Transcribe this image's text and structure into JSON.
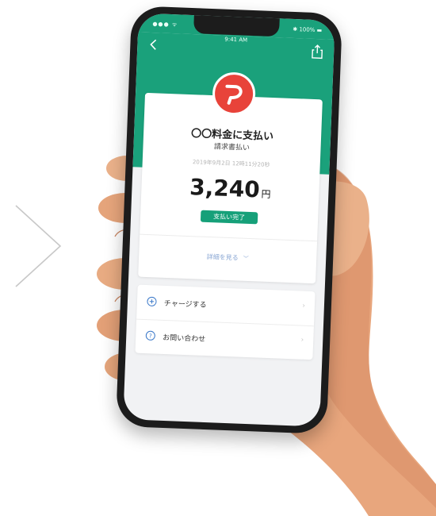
{
  "status_bar": {
    "signal": "●●● ᯤ",
    "time": "9:41 AM",
    "battery": "✱ 100% ▬"
  },
  "header": {
    "back_icon": "chevron-left-icon",
    "share_icon": "share-icon"
  },
  "receipt": {
    "logo_icon": "paypay-logo-icon",
    "title": "〇〇料金に支払い",
    "subtitle": "請求書払い",
    "datetime": "2019年9月2日 12時11分20秒",
    "amount": "3,240",
    "currency": "円",
    "status": "支払い完了",
    "details_link": "詳細を見る",
    "details_icon": "chevron-down-icon"
  },
  "actions": [
    {
      "icon": "plus-circle-icon",
      "label": "チャージする",
      "chevron": "›"
    },
    {
      "icon": "question-circle-icon",
      "label": "お問い合わせ",
      "chevron": "›"
    }
  ],
  "colors": {
    "brand_green": "#1aa17b",
    "logo_red": "#e8433a",
    "badge_green": "#16a079",
    "link_blue": "#8aa7d4"
  }
}
